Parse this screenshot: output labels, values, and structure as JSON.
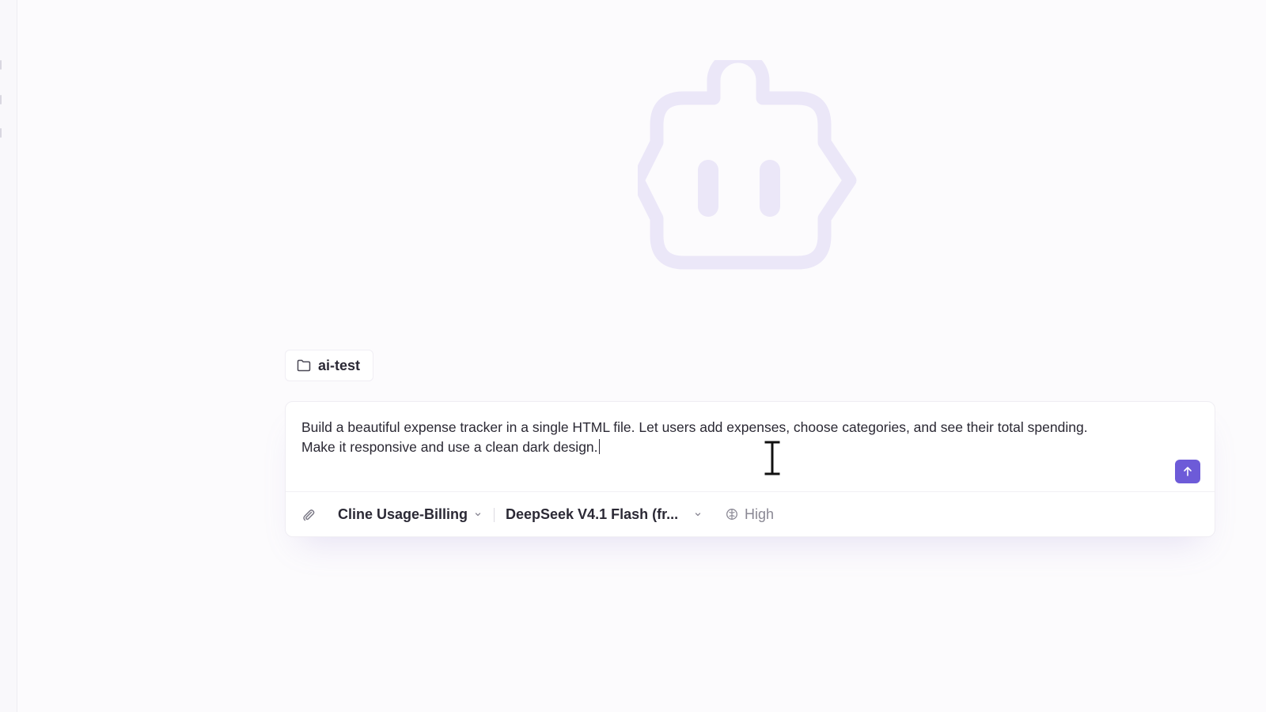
{
  "folder": {
    "icon": "folder-icon",
    "name": "ai-test"
  },
  "composer": {
    "prompt_text": "Build a beautiful expense tracker in a single HTML file. Let users add expenses, choose categories, and see their total spending.\nMake it responsive and use a clean dark design.",
    "send_icon": "arrow-up-icon"
  },
  "toolbar": {
    "attach_icon": "paperclip-icon",
    "account_label": "Cline Usage-Billing",
    "model_label": "DeepSeek V4.1 Flash (fr...",
    "effort_icon": "brain-icon",
    "effort_label": "High"
  },
  "colors": {
    "accent": "#6d5bd8",
    "mascot_tint": "#ebe7f8",
    "background": "#fcfbfd"
  }
}
